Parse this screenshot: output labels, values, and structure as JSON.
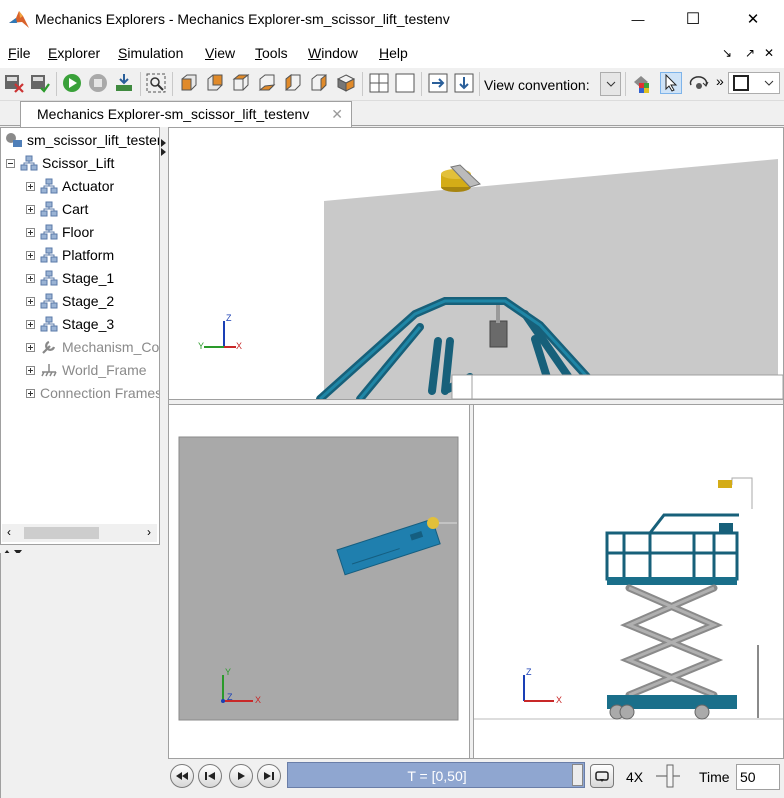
{
  "window": {
    "title": "Mechanics Explorers - Mechanics Explorer-sm_scissor_lift_testenv",
    "minimize": "—",
    "maximize": "☐",
    "close": "✕"
  },
  "menu": {
    "items": [
      {
        "label": "File",
        "key": "F",
        "rest": "ile"
      },
      {
        "label": "Explorer",
        "key": "E",
        "rest": "xplorer"
      },
      {
        "label": "Simulation",
        "key": "S",
        "rest": "imulation"
      },
      {
        "label": "View",
        "key": "V",
        "rest": "iew"
      },
      {
        "label": "Tools",
        "key": "T",
        "rest": "ools"
      },
      {
        "label": "Window",
        "key": "W",
        "rest": "indow"
      },
      {
        "label": "Help",
        "key": "H",
        "rest": "elp"
      }
    ]
  },
  "toolbar": {
    "view_convention_label": "View convention:",
    "overflow": "»"
  },
  "tab": {
    "label": "Mechanics Explorer-sm_scissor_lift_testenv",
    "close": "✕"
  },
  "tree": {
    "root": "sm_scissor_lift_testenv",
    "model": "Scissor_Lift",
    "children": [
      {
        "label": "Actuator",
        "enabled": true
      },
      {
        "label": "Cart",
        "enabled": true
      },
      {
        "label": "Floor",
        "enabled": true
      },
      {
        "label": "Platform",
        "enabled": true
      },
      {
        "label": "Stage_1",
        "enabled": true
      },
      {
        "label": "Stage_2",
        "enabled": true
      },
      {
        "label": "Stage_3",
        "enabled": true
      },
      {
        "label": "Mechanism_Configuration",
        "enabled": false
      },
      {
        "label": "World_Frame",
        "enabled": false
      }
    ],
    "connection_frames": "Connection Frames"
  },
  "triad": {
    "x": "X",
    "y": "Y",
    "z": "Z"
  },
  "playback": {
    "time_range": "T = [0,50]",
    "speed": "4X",
    "time_label": "Time",
    "time_value": "50"
  },
  "colors": {
    "lift_teal": "#1a6f8a",
    "platform_blue": "#2d7ea8",
    "actuator_gold": "#c8a420",
    "view_grey": "#a9a9a9",
    "playbar_blue": "#8fa6d0"
  }
}
